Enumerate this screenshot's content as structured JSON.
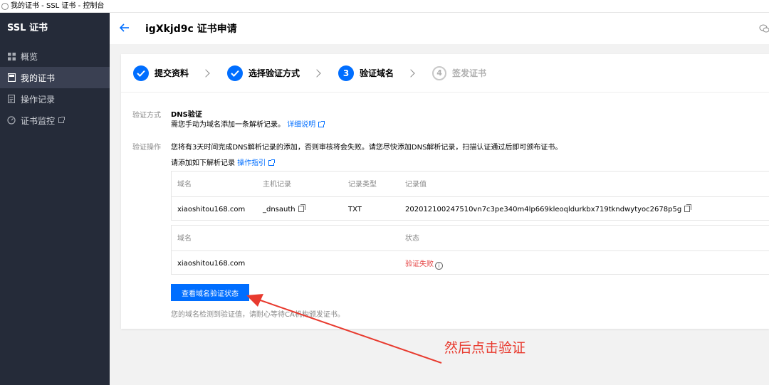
{
  "window": {
    "title": "我的证书 - SSL 证书 - 控制台"
  },
  "sidebar": {
    "brand": "SSL 证书",
    "items": [
      {
        "label": "概览",
        "icon": "grid-icon",
        "active": false
      },
      {
        "label": "我的证书",
        "icon": "certificate-icon",
        "active": true
      },
      {
        "label": "操作记录",
        "icon": "document-icon",
        "active": false
      },
      {
        "label": "证书监控",
        "icon": "monitor-gauge-icon",
        "active": false,
        "external": true
      }
    ]
  },
  "header": {
    "back_icon": "arrow-left-icon",
    "title": "igXkjd9c 证书申请",
    "right_icon": "chat-icon"
  },
  "steps": [
    {
      "label": "提交资料",
      "state": "done"
    },
    {
      "label": "选择验证方式",
      "state": "done"
    },
    {
      "label": "验证域名",
      "state": "current",
      "number": "3"
    },
    {
      "label": "签发证书",
      "state": "pending",
      "number": "4"
    }
  ],
  "verify_method": {
    "label": "验证方式",
    "value": "DNS验证",
    "description": "需您手动为域名添加一条解析记录。",
    "link": "详细说明"
  },
  "verify_action": {
    "label": "验证操作",
    "notice": "您将有3天时间完成DNS解析记录的添加，否则审核将会失败。请您尽快添加DNS解析记录，扫描认证通过后即可颁布证书。",
    "instruction": "请添加如下解析记录",
    "guide_link": "操作指引"
  },
  "dns_table": {
    "headers": [
      "域名",
      "主机记录",
      "记录类型",
      "记录值"
    ],
    "rows": [
      [
        "xiaoshitou168.com",
        "_dnsauth",
        "TXT",
        "202012100247510vn7c3pe340m4lp669kleoqldurkbx719tkndwytyoc2678p5g"
      ]
    ]
  },
  "status_table": {
    "headers": [
      "域名",
      "状态"
    ],
    "rows": [
      [
        "xiaoshitou168.com",
        "验证失败"
      ]
    ]
  },
  "check_button": "查看域名验证状态",
  "hint": "您的域名检测到验证值，请耐心等待CA机构颁发证书。",
  "annotation": {
    "text": "然后点击验证",
    "color": "#e83a2e"
  },
  "colors": {
    "accent": "#006eff",
    "sidebar_bg": "#252b39",
    "fail": "#e54545"
  }
}
